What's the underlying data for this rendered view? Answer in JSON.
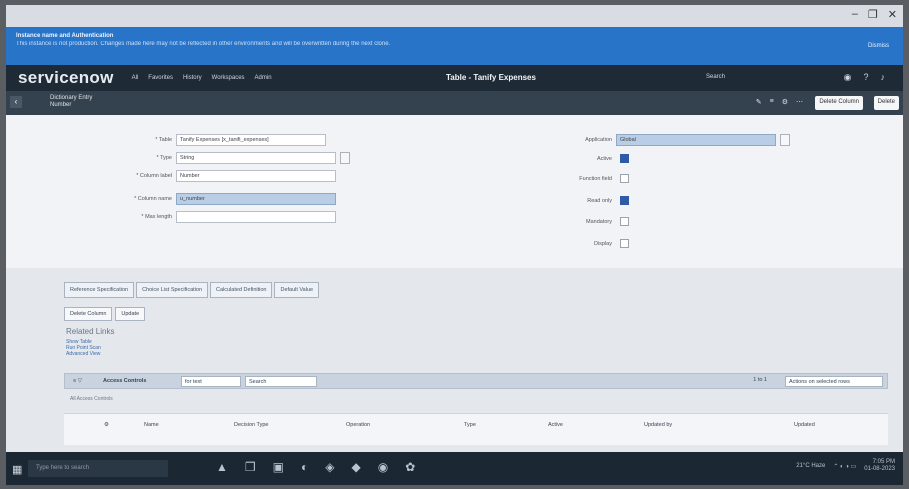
{
  "window": {
    "controls": [
      "–",
      "❐",
      "✕"
    ]
  },
  "banner": {
    "title": "Instance name and Authentication",
    "message": "This instance is not production. Changes made here may not be reflected in other environments and will be overwritten during the next clone.",
    "action": "Dismiss"
  },
  "nav": {
    "logo": "servicenow",
    "menu": [
      "All",
      "Favorites",
      "History",
      "Workspaces",
      "Admin"
    ],
    "page_title": "Table - Tanify Expenses",
    "search_label": "Search"
  },
  "record": {
    "crumb_line1": "Dictionary Entry",
    "crumb_line2": "Number",
    "update_label": "Delete Column",
    "delete_label": "Delete"
  },
  "form": {
    "left": [
      {
        "label": "* Table",
        "value": "Tanify Expenses [x_tanifi_expenses]"
      },
      {
        "label": "* Type",
        "value": "String"
      },
      {
        "label": "* Column label",
        "value": "Number"
      },
      {
        "label": "* Column name",
        "value": "u_number"
      },
      {
        "label": "* Max length",
        "value": ""
      }
    ],
    "right": [
      {
        "label": "Application",
        "value": "Global"
      },
      {
        "label": "Active",
        "checked": true
      },
      {
        "label": "Function field",
        "checked": false
      },
      {
        "label": "Read only",
        "checked": true
      },
      {
        "label": "Mandatory",
        "checked": false
      },
      {
        "label": "Display",
        "checked": false
      }
    ]
  },
  "tabs": [
    "Reference Specification",
    "Choice List Specification",
    "Calculated Definition",
    "Default Value"
  ],
  "sub_buttons": [
    "Delete Column",
    "Update"
  ],
  "related": {
    "title": "Related Links",
    "links": [
      "Show Table",
      "Run Point Scan",
      "Advanced View"
    ]
  },
  "list": {
    "title": "Access Controls",
    "filter_value": "for text",
    "search_placeholder": "Search",
    "right_select": "Actions on selected rows",
    "pager": "1 to 1",
    "crumb": "All Access Controls",
    "columns": [
      "Name",
      "Decision Type",
      "Operation",
      "Type",
      "Active",
      "Updated by",
      "Updated"
    ]
  },
  "taskbar": {
    "search_placeholder": "Type here to search",
    "weather": "21°C Haze",
    "time": "7:05 PM",
    "date": "01-08-2023"
  }
}
